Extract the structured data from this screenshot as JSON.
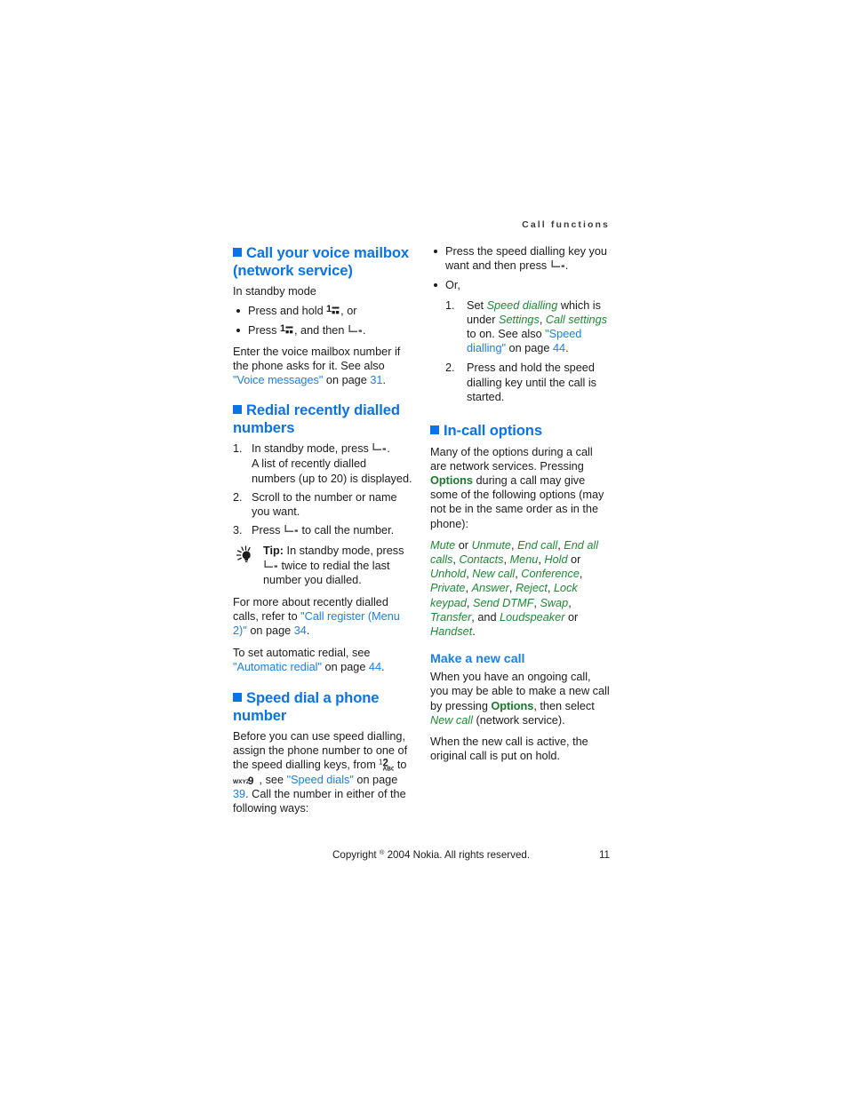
{
  "header": {
    "running_title": "Call functions"
  },
  "footer": {
    "copyright_pre": "Copyright ",
    "copyright_mark": "®",
    "copyright_post": " 2004 Nokia. All rights reserved.",
    "page_number": "11"
  },
  "colors": {
    "heading_blue": "#0b74e5",
    "subheading_blue": "#1b7fe8",
    "link_blue": "#1b7fe8",
    "ui_green": "#1d8a34",
    "ui_green_bold": "#177a2a",
    "body_text": "#1c1c1c"
  },
  "left_column": {
    "section_voice_mailbox": {
      "heading_line1": "Call your voice mailbox",
      "heading_line2": "(network service)",
      "intro": "In standby mode",
      "bullets": [
        {
          "pre": "Press and hold ",
          "key": "key-1-voicemail",
          "post": ", or"
        },
        {
          "pre": "Press ",
          "key": "key-1-voicemail",
          "mid": ", and then ",
          "key2": "key-call",
          "post": "."
        }
      ],
      "paragraph": {
        "t1": "Enter the voice mailbox number if the phone asks for it. See also ",
        "link": "\"Voice messages\"",
        "t2": " on page ",
        "page": "31",
        "t3": "."
      }
    },
    "section_redial": {
      "heading_line1": "Redial recently dialled",
      "heading_line2": "numbers",
      "steps": [
        {
          "num": "1.",
          "pre": "In standby mode, press ",
          "key": "key-call",
          "post": ".",
          "sub": "A list of recently dialled numbers (up to 20) is displayed."
        },
        {
          "num": "2.",
          "pre": "Scroll to the number or name you want.",
          "post": ""
        },
        {
          "num": "3.",
          "pre": "Press ",
          "key": "key-call",
          "post": " to call the number."
        }
      ],
      "tip": {
        "icon": "lightbulb-icon",
        "label": "Tip:",
        "pre": " In standby mode, press ",
        "key": "key-call",
        "post": " twice to redial the last number you dialled."
      },
      "paragraph1": {
        "t1": "For more about recently dialled calls, refer to ",
        "link": "\"Call register (Menu 2)\"",
        "t2": " on page ",
        "page": "34",
        "t3": "."
      },
      "paragraph2": {
        "t1": "To set automatic redial, see ",
        "link": "\"Automatic redial\"",
        "t2": " on page ",
        "page": "44",
        "t3": "."
      }
    },
    "section_speed_dial": {
      "heading_line1": "Speed dial a phone",
      "heading_line2": "number",
      "paragraph": {
        "t1": "Before you can use speed dialling, assign the phone number to one of the speed dialling keys, from ",
        "key_from": "key-2-abc",
        "t2": " to ",
        "key_to": "key-9-wxyz",
        "t3": " , see ",
        "link": "\"Speed dials\"",
        "t4": " on page ",
        "page": "39",
        "t5": ". Call the number in either of the following ways:"
      }
    }
  },
  "right_column": {
    "speed_dial_bullets": {
      "bullet1": {
        "pre": "Press the speed dialling key you want and then press ",
        "key": "key-call",
        "post": "."
      },
      "bullet2_label": "Or,",
      "sub_steps": [
        {
          "num": "1.",
          "t1": "Set ",
          "ui1": "Speed dialling",
          "t2": " which is under ",
          "ui2": "Settings",
          "t3": ", ",
          "ui3": "Call settings",
          "t4": " to on. See also ",
          "link": "\"Speed dialling\"",
          "t5": " on page ",
          "page": "44",
          "t6": "."
        },
        {
          "num": "2.",
          "t1": "Press and hold the speed dialling key until the call is started."
        }
      ]
    },
    "section_incall": {
      "heading": "In-call options",
      "paragraph": {
        "t1": "Many of the options during a call are network services. Pressing ",
        "bold_ui": "Options",
        "t2": " during a call may give some of the following options (may not be in the same order as in the phone):"
      },
      "options_list": {
        "items": [
          "Mute",
          "Unmute",
          "End call",
          "End all calls",
          "Contacts",
          "Menu",
          "Hold",
          "Unhold",
          "New call",
          "Conference",
          "Private",
          "Answer",
          "Reject",
          "Lock keypad",
          "Send DTMF",
          "Swap",
          "Transfer",
          "Loudspeaker",
          "Handset"
        ],
        "sep_or": " or ",
        "sep_comma": ", ",
        "trailing_and": "and ",
        "period": "."
      }
    },
    "section_make_new_call": {
      "heading": "Make a new call",
      "paragraph1": {
        "t1": "When you have an ongoing call, you may be able to make a new call by pressing ",
        "bold_ui": "Options",
        "t2": ", then select ",
        "ui": "New call",
        "t3": " (network service)."
      },
      "paragraph2": "When the new call is active, the original call is put on hold."
    }
  }
}
